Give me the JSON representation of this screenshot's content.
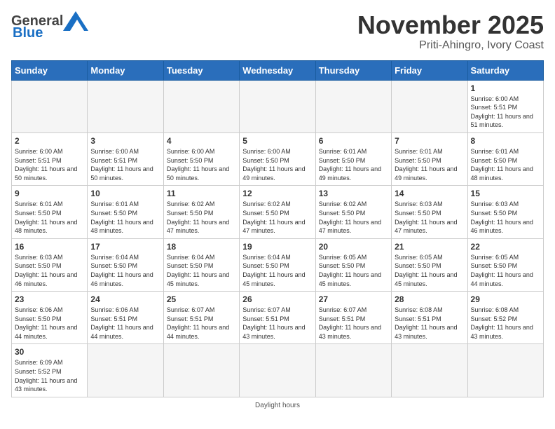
{
  "header": {
    "logo_general": "General",
    "logo_blue": "Blue",
    "title": "November 2025",
    "subtitle": "Priti-Ahingro, Ivory Coast"
  },
  "weekdays": [
    "Sunday",
    "Monday",
    "Tuesday",
    "Wednesday",
    "Thursday",
    "Friday",
    "Saturday"
  ],
  "days": [
    {
      "date": null,
      "sunrise": null,
      "sunset": null,
      "daylight": null
    },
    {
      "date": null,
      "sunrise": null,
      "sunset": null,
      "daylight": null
    },
    {
      "date": null,
      "sunrise": null,
      "sunset": null,
      "daylight": null
    },
    {
      "date": null,
      "sunrise": null,
      "sunset": null,
      "daylight": null
    },
    {
      "date": null,
      "sunrise": null,
      "sunset": null,
      "daylight": null
    },
    {
      "date": null,
      "sunrise": null,
      "sunset": null,
      "daylight": null
    },
    {
      "date": "1",
      "sunrise": "6:00 AM",
      "sunset": "5:51 PM",
      "daylight": "11 hours and 51 minutes."
    },
    {
      "date": "2",
      "sunrise": "6:00 AM",
      "sunset": "5:51 PM",
      "daylight": "11 hours and 50 minutes."
    },
    {
      "date": "3",
      "sunrise": "6:00 AM",
      "sunset": "5:51 PM",
      "daylight": "11 hours and 50 minutes."
    },
    {
      "date": "4",
      "sunrise": "6:00 AM",
      "sunset": "5:50 PM",
      "daylight": "11 hours and 50 minutes."
    },
    {
      "date": "5",
      "sunrise": "6:00 AM",
      "sunset": "5:50 PM",
      "daylight": "11 hours and 49 minutes."
    },
    {
      "date": "6",
      "sunrise": "6:01 AM",
      "sunset": "5:50 PM",
      "daylight": "11 hours and 49 minutes."
    },
    {
      "date": "7",
      "sunrise": "6:01 AM",
      "sunset": "5:50 PM",
      "daylight": "11 hours and 49 minutes."
    },
    {
      "date": "8",
      "sunrise": "6:01 AM",
      "sunset": "5:50 PM",
      "daylight": "11 hours and 48 minutes."
    },
    {
      "date": "9",
      "sunrise": "6:01 AM",
      "sunset": "5:50 PM",
      "daylight": "11 hours and 48 minutes."
    },
    {
      "date": "10",
      "sunrise": "6:01 AM",
      "sunset": "5:50 PM",
      "daylight": "11 hours and 48 minutes."
    },
    {
      "date": "11",
      "sunrise": "6:02 AM",
      "sunset": "5:50 PM",
      "daylight": "11 hours and 47 minutes."
    },
    {
      "date": "12",
      "sunrise": "6:02 AM",
      "sunset": "5:50 PM",
      "daylight": "11 hours and 47 minutes."
    },
    {
      "date": "13",
      "sunrise": "6:02 AM",
      "sunset": "5:50 PM",
      "daylight": "11 hours and 47 minutes."
    },
    {
      "date": "14",
      "sunrise": "6:03 AM",
      "sunset": "5:50 PM",
      "daylight": "11 hours and 47 minutes."
    },
    {
      "date": "15",
      "sunrise": "6:03 AM",
      "sunset": "5:50 PM",
      "daylight": "11 hours and 46 minutes."
    },
    {
      "date": "16",
      "sunrise": "6:03 AM",
      "sunset": "5:50 PM",
      "daylight": "11 hours and 46 minutes."
    },
    {
      "date": "17",
      "sunrise": "6:04 AM",
      "sunset": "5:50 PM",
      "daylight": "11 hours and 46 minutes."
    },
    {
      "date": "18",
      "sunrise": "6:04 AM",
      "sunset": "5:50 PM",
      "daylight": "11 hours and 45 minutes."
    },
    {
      "date": "19",
      "sunrise": "6:04 AM",
      "sunset": "5:50 PM",
      "daylight": "11 hours and 45 minutes."
    },
    {
      "date": "20",
      "sunrise": "6:05 AM",
      "sunset": "5:50 PM",
      "daylight": "11 hours and 45 minutes."
    },
    {
      "date": "21",
      "sunrise": "6:05 AM",
      "sunset": "5:50 PM",
      "daylight": "11 hours and 45 minutes."
    },
    {
      "date": "22",
      "sunrise": "6:05 AM",
      "sunset": "5:50 PM",
      "daylight": "11 hours and 44 minutes."
    },
    {
      "date": "23",
      "sunrise": "6:06 AM",
      "sunset": "5:50 PM",
      "daylight": "11 hours and 44 minutes."
    },
    {
      "date": "24",
      "sunrise": "6:06 AM",
      "sunset": "5:51 PM",
      "daylight": "11 hours and 44 minutes."
    },
    {
      "date": "25",
      "sunrise": "6:07 AM",
      "sunset": "5:51 PM",
      "daylight": "11 hours and 44 minutes."
    },
    {
      "date": "26",
      "sunrise": "6:07 AM",
      "sunset": "5:51 PM",
      "daylight": "11 hours and 43 minutes."
    },
    {
      "date": "27",
      "sunrise": "6:07 AM",
      "sunset": "5:51 PM",
      "daylight": "11 hours and 43 minutes."
    },
    {
      "date": "28",
      "sunrise": "6:08 AM",
      "sunset": "5:51 PM",
      "daylight": "11 hours and 43 minutes."
    },
    {
      "date": "29",
      "sunrise": "6:08 AM",
      "sunset": "5:52 PM",
      "daylight": "11 hours and 43 minutes."
    },
    {
      "date": "30",
      "sunrise": "6:09 AM",
      "sunset": "5:52 PM",
      "daylight": "11 hours and 43 minutes."
    }
  ],
  "footer": {
    "note": "Daylight hours"
  }
}
